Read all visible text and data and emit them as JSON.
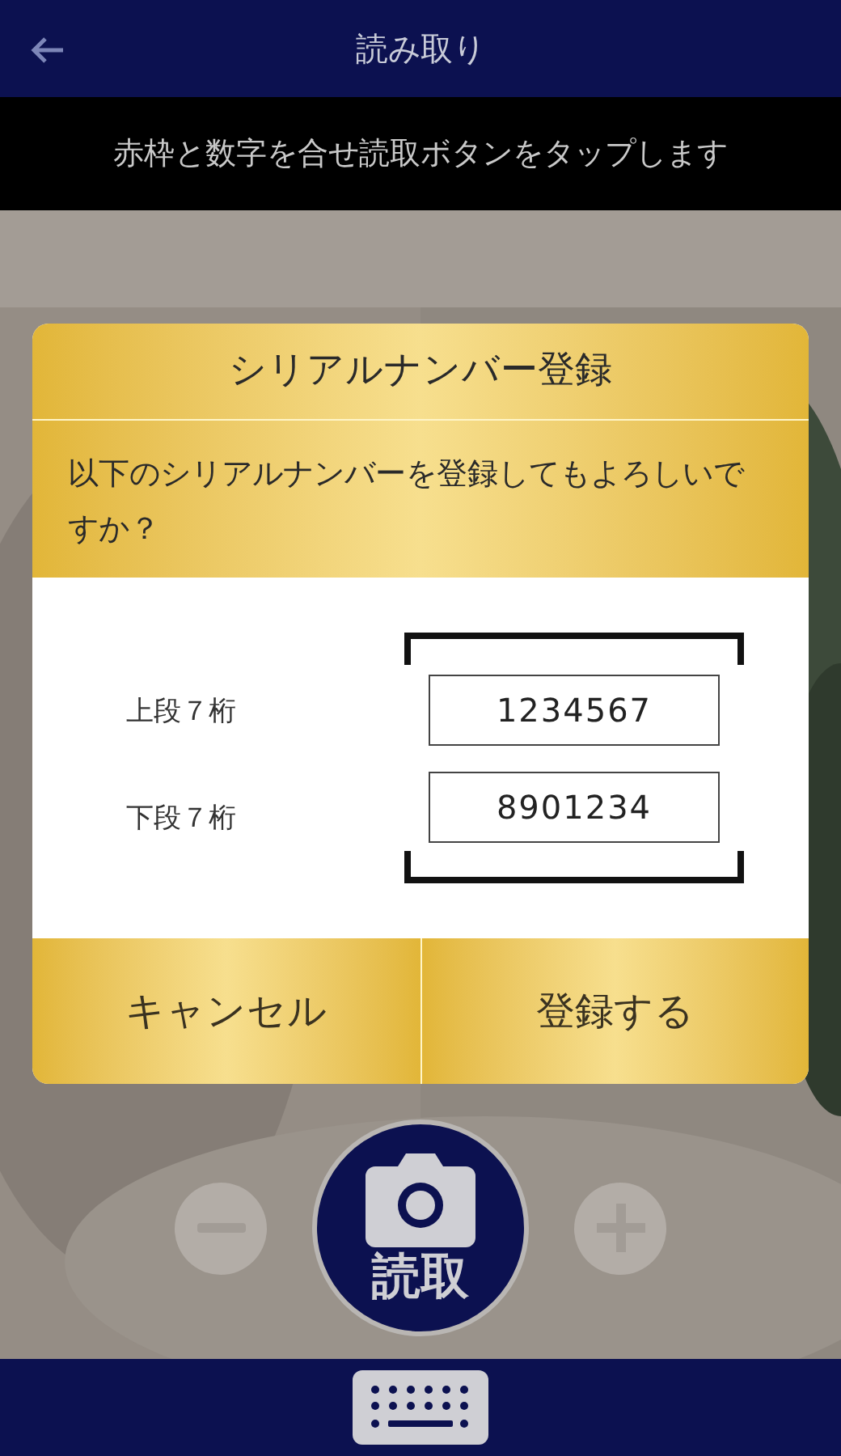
{
  "header": {
    "title": "読み取り"
  },
  "instruction": "赤枠と数字を合せ読取ボタンをタップします",
  "dialog": {
    "title": "シリアルナンバー登録",
    "message": "以下のシリアルナンバーを登録してもよろしいですか？",
    "fields": [
      {
        "label": "上段７桁",
        "value": "1234567"
      },
      {
        "label": "下段７桁",
        "value": "8901234"
      }
    ],
    "buttons": [
      "キャンセル",
      "登録する"
    ]
  },
  "capture_button": {
    "label": "読取"
  }
}
